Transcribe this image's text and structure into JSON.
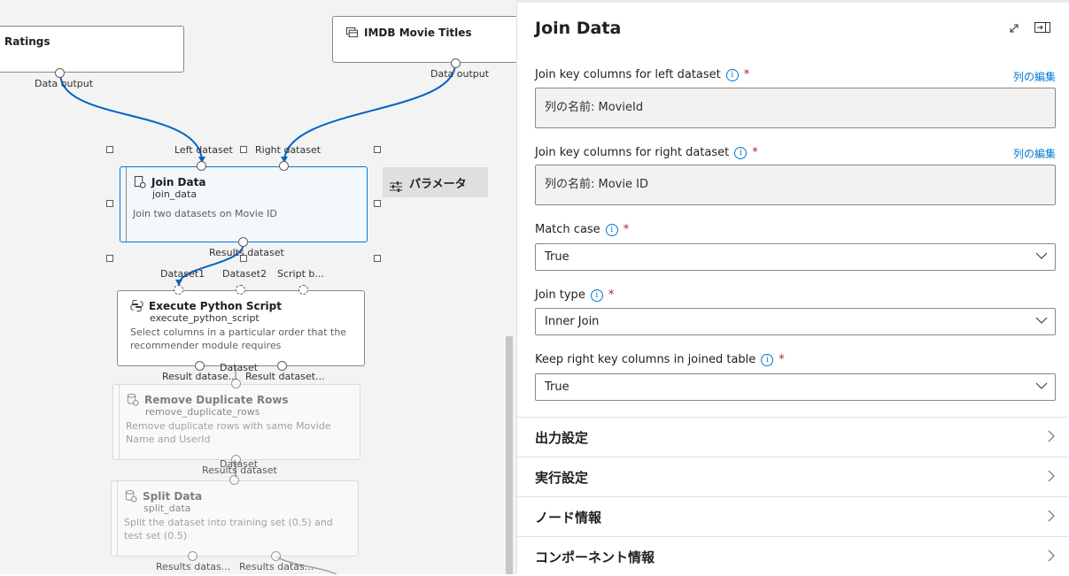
{
  "canvas": {
    "nodes": {
      "ratings": {
        "title": "Ratings",
        "output_label": "Data output"
      },
      "imdb": {
        "title": "IMDB Movie Titles",
        "output_label": "Data output"
      },
      "join": {
        "title": "Join Data",
        "subtitle": "join_data",
        "description": "Join two datasets on Movie ID",
        "in_left": "Left dataset",
        "in_right": "Right dataset",
        "out": "Results dataset"
      },
      "python": {
        "title": "Execute Python Script",
        "subtitle": "execute_python_script",
        "description": "Select columns in a particular order that the recommender module requires",
        "in1": "Dataset1",
        "in2": "Dataset2",
        "in3": "Script b...",
        "out1": "Result datase...",
        "out2": "Result dataset..."
      },
      "dedup": {
        "title": "Remove Duplicate Rows",
        "subtitle": "remove_duplicate_rows",
        "description": "Remove duplicate rows with same Movide Name and UserId",
        "in": "Dataset",
        "out": "Results dataset"
      },
      "split": {
        "title": "Split Data",
        "subtitle": "split_data",
        "description": "Split the dataset into training set (0.5) and test set (0.5)",
        "in": "Dataset",
        "out1": "Results datas...",
        "out2": "Results datas..."
      }
    },
    "param_button": "パラメータ"
  },
  "panel": {
    "title": "Join Data",
    "fields": {
      "left_key": {
        "label": "Join key columns for left dataset",
        "value": "列の名前: MovieId",
        "edit": "列の編集"
      },
      "right_key": {
        "label": "Join key columns for right dataset",
        "value": "列の名前: Movie ID",
        "edit": "列の編集"
      },
      "match_case": {
        "label": "Match case",
        "value": "True"
      },
      "join_type": {
        "label": "Join type",
        "value": "Inner Join"
      },
      "keep_right": {
        "label": "Keep right key columns in joined table",
        "value": "True"
      }
    },
    "sections": [
      "出力設定",
      "実行設定",
      "ノード情報",
      "コンポーネント情報"
    ]
  },
  "colors": {
    "accent": "#0078d4",
    "required": "#a4262c",
    "canvas_bg": "#f3f3f3"
  },
  "icons": {
    "dataset": "dataset-icon",
    "module": "module-icon",
    "python": "python-icon",
    "expand": "expand-icon",
    "dock": "dock-panel-icon",
    "params": "sliders-icon",
    "info": "info-icon",
    "chevron": "chevron-icon"
  }
}
